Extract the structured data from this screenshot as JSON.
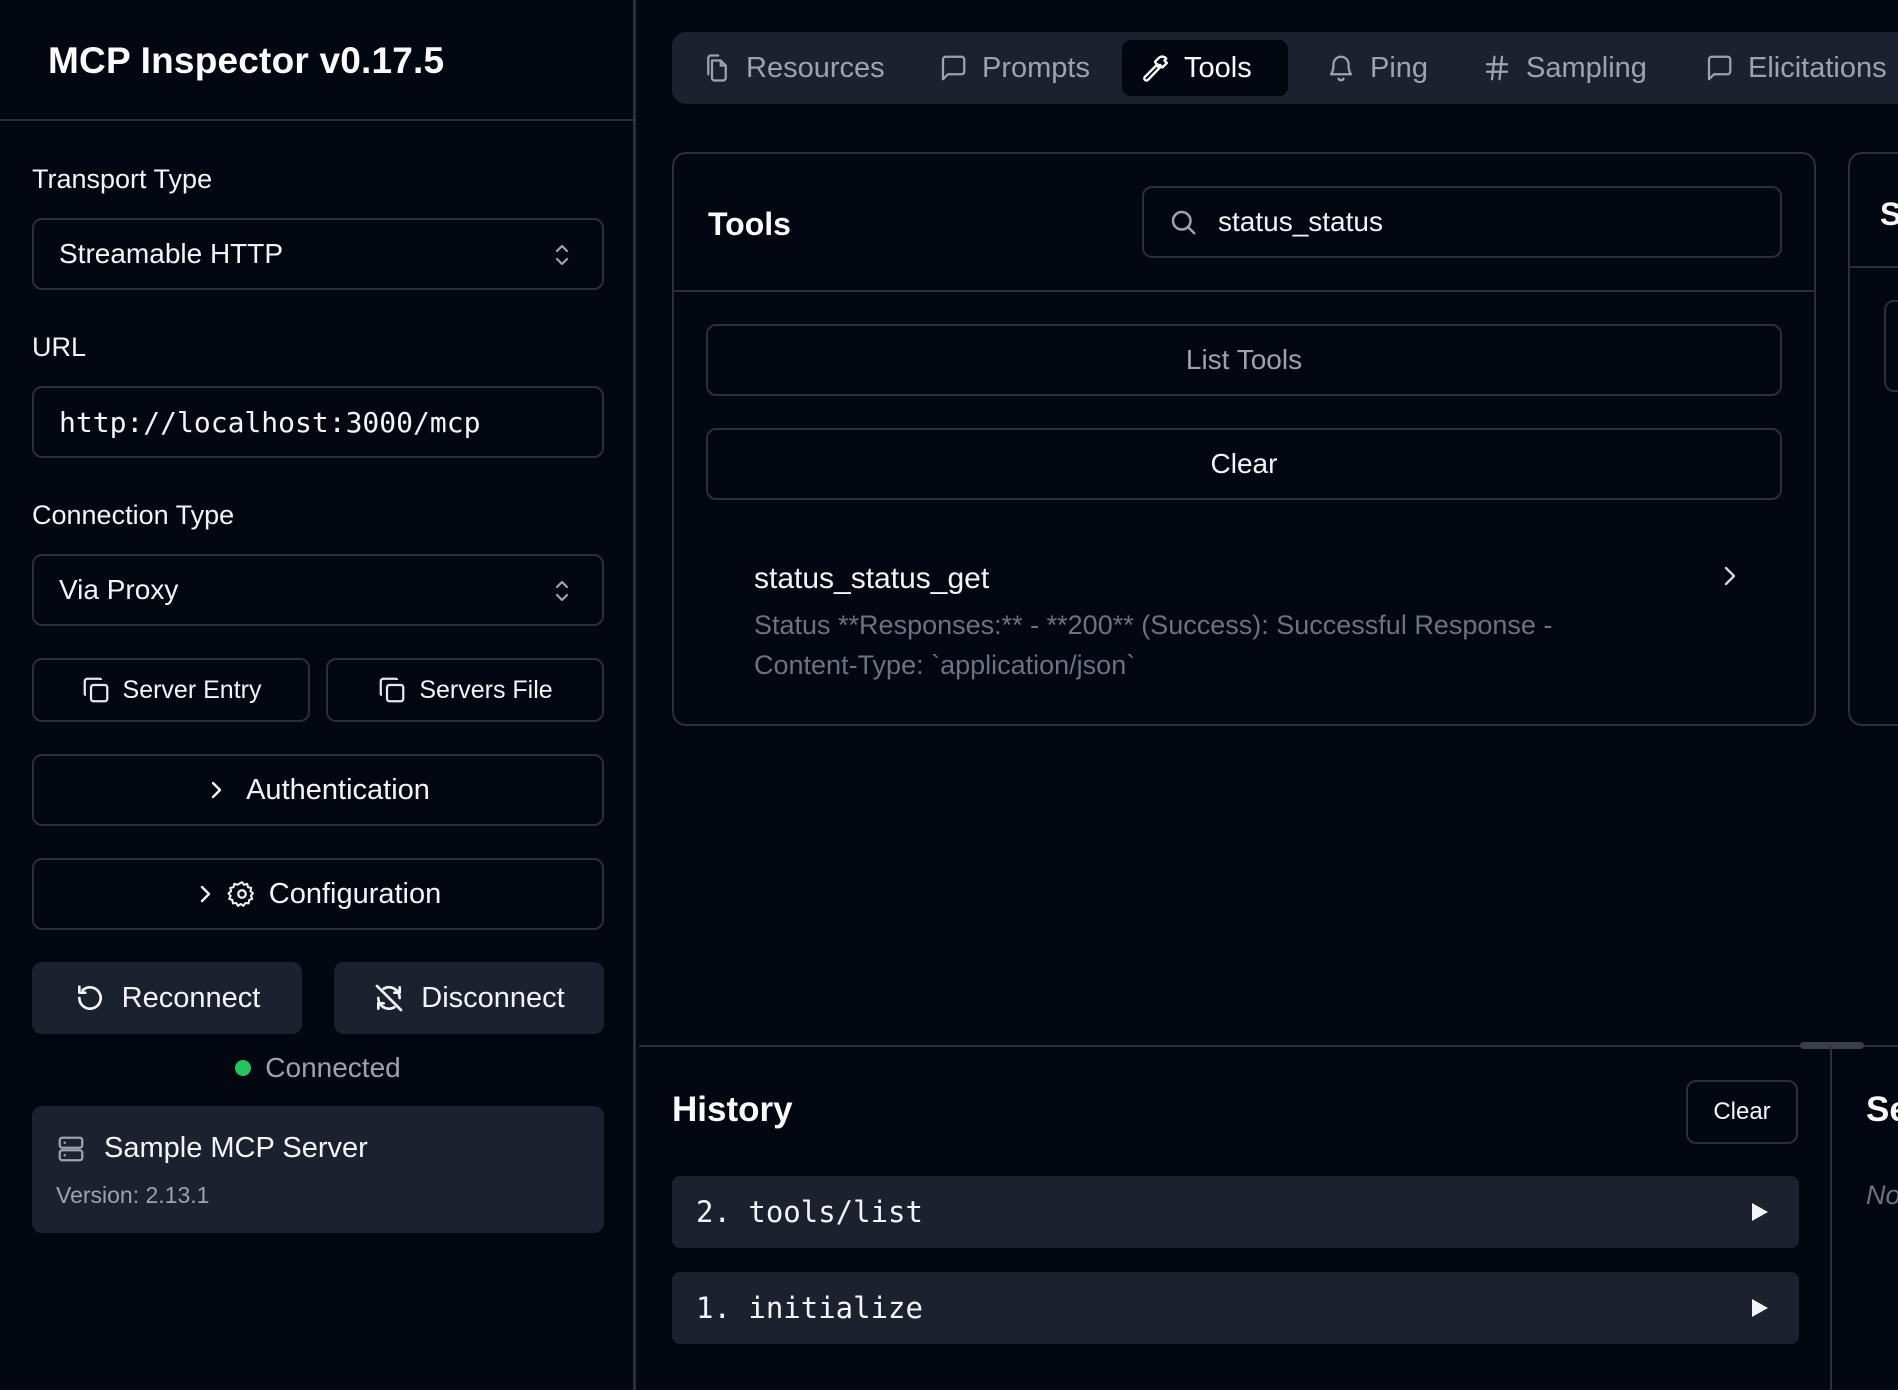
{
  "app": {
    "title": "MCP Inspector v0.17.5"
  },
  "sidebar": {
    "transport_label": "Transport Type",
    "transport_value": "Streamable HTTP",
    "url_label": "URL",
    "url_value": "http://localhost:3000/mcp",
    "connection_label": "Connection Type",
    "connection_value": "Via Proxy",
    "server_entry_label": "Server Entry",
    "servers_file_label": "Servers File",
    "authentication_label": "Authentication",
    "configuration_label": "Configuration",
    "reconnect_label": "Reconnect",
    "disconnect_label": "Disconnect",
    "status_text": "Connected",
    "status_color": "#22c55e",
    "server": {
      "name": "Sample MCP Server",
      "version": "Version: 2.13.1"
    }
  },
  "tabs": [
    {
      "label": "Resources",
      "icon": "files-icon",
      "active": false
    },
    {
      "label": "Prompts",
      "icon": "message-square-icon",
      "active": false
    },
    {
      "label": "Tools",
      "icon": "hammer-icon",
      "active": true
    },
    {
      "label": "Ping",
      "icon": "bell-icon",
      "active": false
    },
    {
      "label": "Sampling",
      "icon": "hash-icon",
      "active": false
    },
    {
      "label": "Elicitations",
      "icon": "message-square-icon",
      "active": false
    }
  ],
  "tools_panel": {
    "title": "Tools",
    "search_value": "status_status",
    "list_button": "List Tools",
    "clear_button": "Clear",
    "items": [
      {
        "name": "status_status_get",
        "description_line1": "Status **Responses:** - **200** (Success): Successful Response -",
        "description_line2": "Content-Type: `application/json`"
      }
    ]
  },
  "right_panel": {
    "title_fragment": "S"
  },
  "history": {
    "title": "History",
    "clear_button": "Clear",
    "items": [
      "2. tools/list",
      "1. initialize"
    ]
  },
  "server_notifications": {
    "title_fragment": "Se",
    "empty_fragment": "No"
  }
}
